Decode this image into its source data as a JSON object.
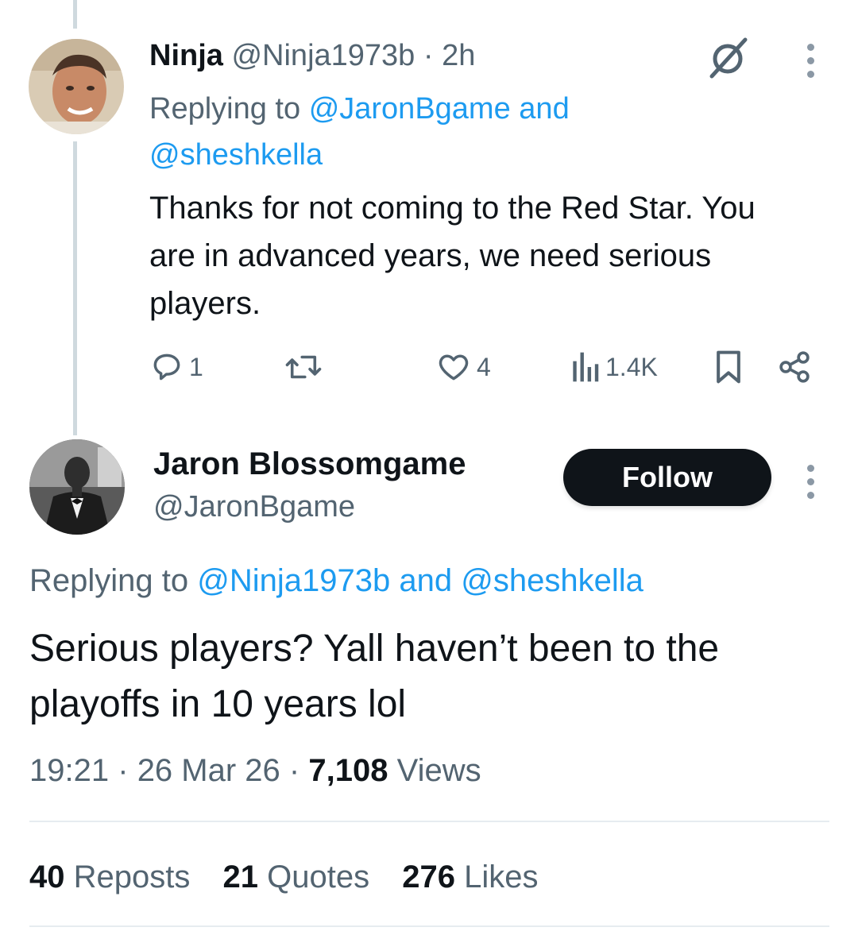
{
  "reply": {
    "name": "Ninja",
    "handle": "@Ninja1973b",
    "sep": "·",
    "time": "2h",
    "replying_prefix": "Replying to",
    "replying_to_1": "@JaronBgame",
    "replying_and": "and",
    "replying_to_2": "@sheshkella",
    "text": "Thanks for not coming to the Red Star. You are in advanced years, we need serious players.",
    "counts": {
      "replies": "1",
      "reposts": "",
      "likes": "4",
      "views": "1.4K"
    }
  },
  "main": {
    "name": "Jaron Blossomgame",
    "handle": "@JaronBgame",
    "follow_label": "Follow",
    "replying_prefix": "Replying to",
    "replying_to_1": "@Ninja1973b",
    "replying_and": "and",
    "replying_to_2": "@sheshkella",
    "text": "Serious players? Yall haven’t been to the playoffs in 10 years lol",
    "time": "19:21",
    "sep": "·",
    "date": "26 Mar 26",
    "views_count": "7,108",
    "views_label": "Views"
  },
  "stats": {
    "reposts_count": "40",
    "reposts_label": "Reposts",
    "quotes_count": "21",
    "quotes_label": "Quotes",
    "likes_count": "276",
    "likes_label": "Likes"
  },
  "colors": {
    "text": "#0f1419",
    "muted": "#536471",
    "link": "#1d9bf0",
    "button_bg": "#0f1419",
    "divider": "#e6ecf0"
  },
  "icons": {
    "reply": "reply-icon",
    "repost": "repost-icon",
    "like": "heart-icon",
    "views": "views-icon",
    "bookmark": "bookmark-icon",
    "share": "share-icon",
    "grok": "grok-icon",
    "more": "more-vertical-icon"
  }
}
